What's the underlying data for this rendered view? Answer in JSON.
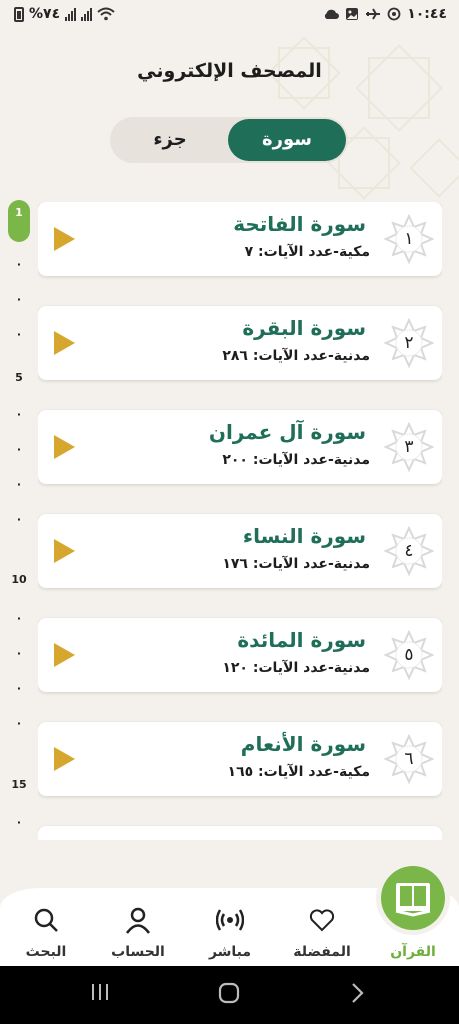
{
  "status_bar": {
    "battery_percent": "%٧٤",
    "time": "١٠:٤٤"
  },
  "header": {
    "title": "المصحف الإلكتروني"
  },
  "toggle": {
    "juz_label": "جزء",
    "surah_label": "سورة",
    "selected": "سورة"
  },
  "side_index": {
    "current": "1",
    "marks": [
      "5",
      "10",
      "15"
    ]
  },
  "surahs": [
    {
      "number": "١",
      "name": "سورة الفاتحة",
      "info": "مكية-عدد الآيات: ٧"
    },
    {
      "number": "٢",
      "name": "سورة البقرة",
      "info": "مدنية-عدد الآيات: ٢٨٦"
    },
    {
      "number": "٣",
      "name": "سورة آل عمران",
      "info": "مدنية-عدد الآيات: ٢٠٠"
    },
    {
      "number": "٤",
      "name": "سورة النساء",
      "info": "مدنية-عدد الآيات: ١٧٦"
    },
    {
      "number": "٥",
      "name": "سورة المائدة",
      "info": "مدنية-عدد الآيات: ١٢٠"
    },
    {
      "number": "٦",
      "name": "سورة الأنعام",
      "info": "مكية-عدد الآيات: ١٦٥"
    }
  ],
  "bottom_nav": {
    "search": "البحث",
    "account": "الحساب",
    "live": "مباشر",
    "favorites": "المفضلة",
    "quran": "القرآن"
  },
  "colors": {
    "primary_green": "#1f6e58",
    "accent_lime": "#7ab648",
    "play_gold": "#d6a62f",
    "background": "#f4f1ec"
  }
}
